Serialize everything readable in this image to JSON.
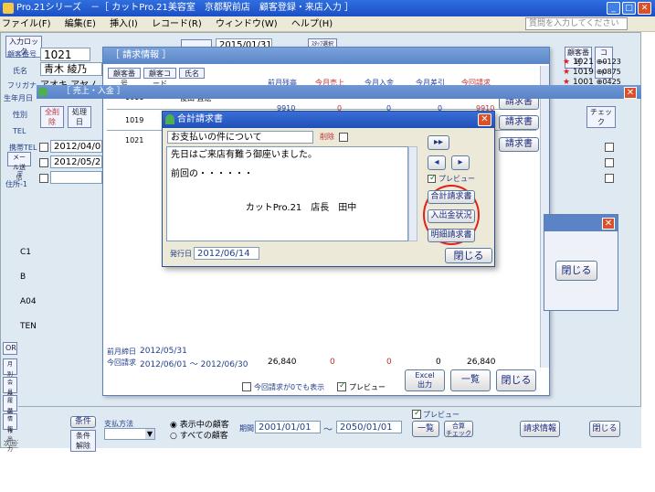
{
  "window": {
    "title": "Pro.21シリーズ　－［ カットPro.21美容室　京都駅前店　顧客登録・来店入力 ］",
    "help_placeholder": "質問を入力してください"
  },
  "menu": [
    "ファイル(F)",
    "編集(E)",
    "挿入(I)",
    "レコード(R)",
    "ウィンドウ(W)",
    "ヘルプ(H)"
  ],
  "customer": {
    "input_lock": "入力ロック",
    "id_label": "顧客番号",
    "id_value": "1021",
    "name_label": "氏名",
    "name_value": "青木 綾乃",
    "kana_label": "フリガナ",
    "kana_value": "アオキ アヤノ",
    "birth_label": "生年月日",
    "sex_label": "性別",
    "tel_label": "TEL",
    "mobile_label": "携帯TEL",
    "mail_label": "メール送信",
    "zip_label": "〒",
    "address_label": "住所-1",
    "row_letters": [
      "C1",
      "B",
      "A04",
      "TEN"
    ],
    "side_buttons": [
      "OR",
      "月別履歴",
      "会員詳細",
      "履歴情報",
      "情報出力"
    ]
  },
  "top_bar": {
    "date_value": "2015/01/31",
    "small_label": "ｽﾀｯﾌ選択"
  },
  "right_list": {
    "head_tags": [
      "顧客番号",
      "コード"
    ],
    "rows": [
      {
        "star": "★",
        "id": "1021",
        "code": "⊕0123"
      },
      {
        "star": "★",
        "id": "1019",
        "code": "⊕0875"
      },
      {
        "star": "★",
        "id": "1001",
        "code": "⊕0425"
      }
    ]
  },
  "seikyu": {
    "title": "［ 請求情報 ］",
    "tabs": [
      "顧客番号",
      "顧客コード",
      "氏名"
    ],
    "columns": [
      "前月残高",
      "今月売上",
      "今月入金",
      "今月差引",
      "今回請求"
    ],
    "rows": [
      {
        "id": "1011",
        "code": "⊕0425",
        "name": "後田 直絵",
        "zan": "9910",
        "uri": "0",
        "nyu": "0",
        "sa": "0",
        "sei": "9910",
        "btn": "請求書"
      },
      {
        "id": "1019",
        "code": "",
        "name": "",
        "zan": "",
        "uri": "",
        "nyu": "",
        "sa": "",
        "sei": "",
        "btn": "請求書"
      },
      {
        "id": "1021",
        "code": "",
        "name": "",
        "zan": "",
        "uri": "",
        "nyu": "",
        "sa": "",
        "sei": "",
        "btn": "請求書"
      }
    ],
    "prev_label": "前月締日",
    "prev_date": "2012/05/31",
    "this_label": "今回請求",
    "this_range": "2012/06/01 ～ 2012/06/30",
    "totals": [
      "26,840",
      "0",
      "0",
      "0",
      "26,840"
    ],
    "zero_label": "今回請求が0でも表示",
    "preview_label": "プレビュー",
    "excel_label": "Excel\n出力",
    "list_label": "一覧",
    "close_label": "閉じる"
  },
  "uriage": {
    "title": "［ 売上・入金 ］",
    "new_tag": "全削除",
    "sub_tag": "処理日",
    "dates": [
      "2012/04/01",
      "2012/05/26",
      ""
    ],
    "check_tag": "チェック"
  },
  "dialog": {
    "title": "合計請求書",
    "subject": "お支払いの件について",
    "delete_label": "削除",
    "body_line1": "先日はご来店有難う御座いました。",
    "body_line2": "前回の・・・・・・",
    "signature": "カットPro.21　店長　田中",
    "preview_label": "プレビュー",
    "btn_total": "合計請求書",
    "btn_inout": "入出金状況",
    "btn_detail": "明細請求書",
    "issue_label": "発行日",
    "issue_date": "2012/06/14",
    "close_label": "閉じる",
    "nav_double": "▸▸",
    "nav_left": "◂",
    "nav_right": "▸"
  },
  "small_win": {
    "close_label": "閉じる"
  },
  "bottom": {
    "cond_label": "条件",
    "cond_clear": "条件解除",
    "payment_label": "支払方法",
    "radio_show": "表示中の顧客",
    "radio_all": "すべての顧客",
    "period_label": "期間",
    "from": "2001/01/01",
    "to": "2050/01/01",
    "preview_label": "プレビュー",
    "list_label": "一覧",
    "aggregate_label": "合算\nチェック",
    "seikyu_label": "請求情報",
    "close_label": "閉じる",
    "next_label": "次回予約"
  }
}
